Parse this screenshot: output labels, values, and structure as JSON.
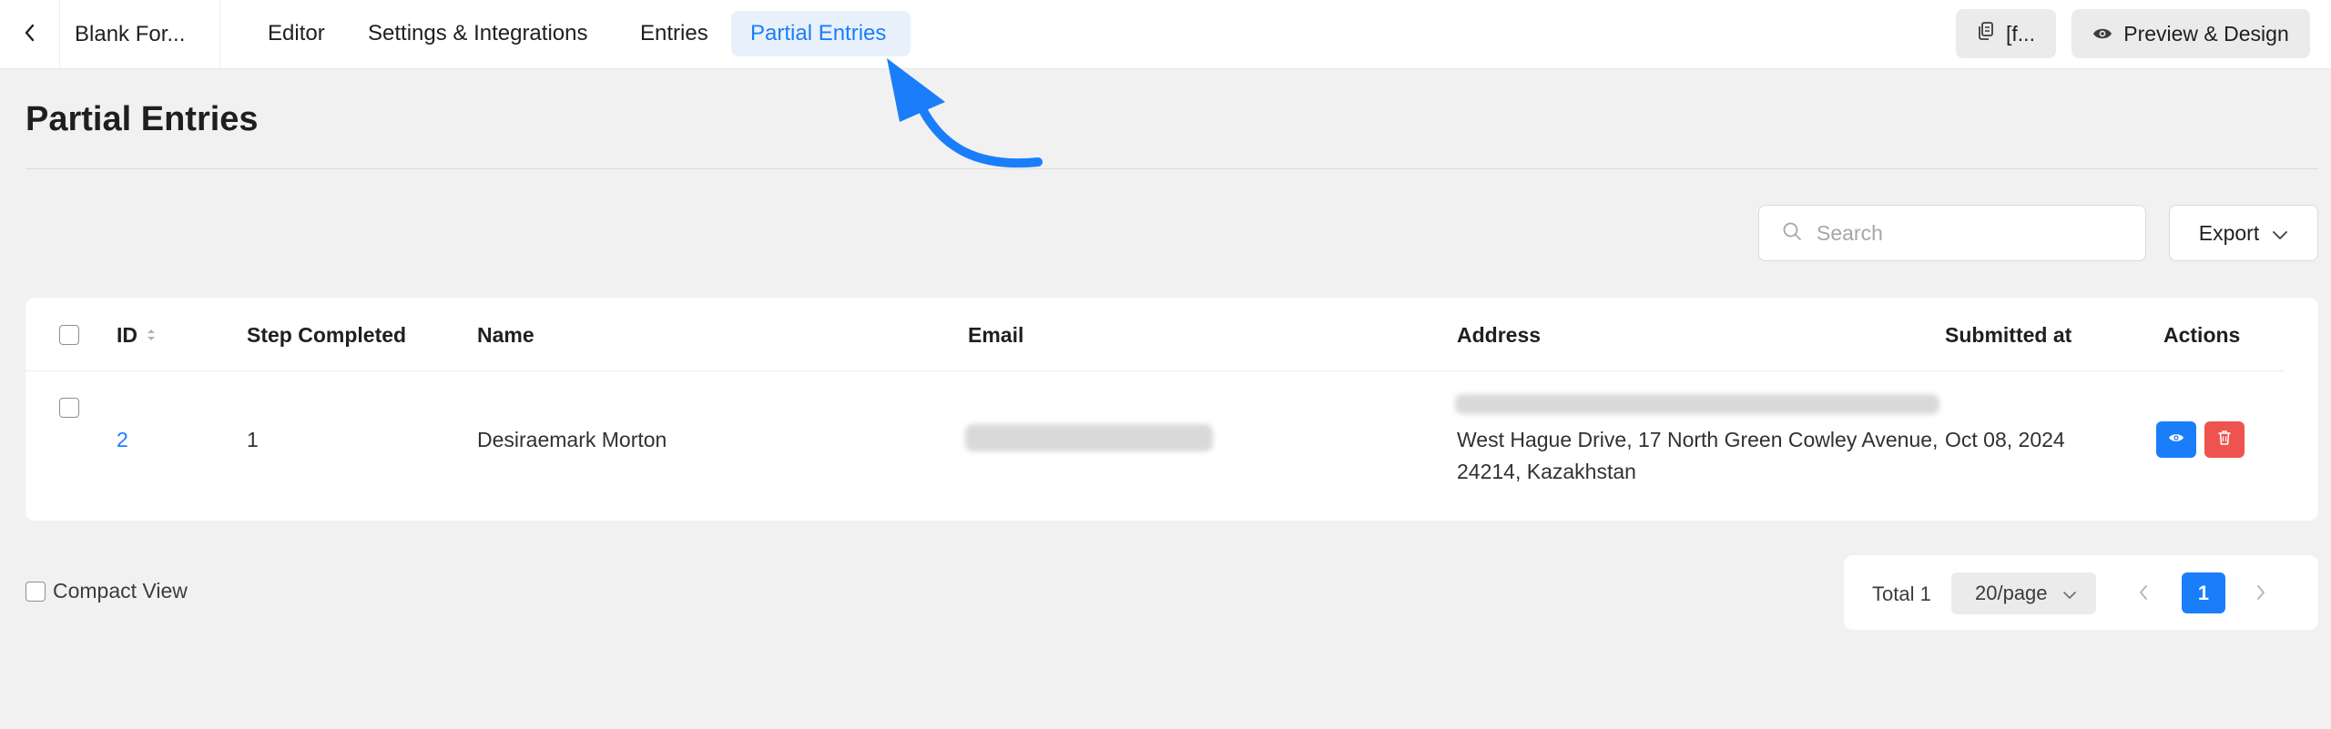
{
  "header": {
    "form_title": "Blank For...",
    "tabs": [
      {
        "label": "Editor"
      },
      {
        "label": "Settings & Integrations"
      },
      {
        "label": "Entries"
      },
      {
        "label": "Partial Entries",
        "active": true
      }
    ],
    "shortcode_label": "[f...",
    "preview_label": "Preview & Design"
  },
  "page": {
    "title": "Partial Entries"
  },
  "toolbar": {
    "search_placeholder": "Search",
    "export_label": "Export"
  },
  "table": {
    "columns": [
      "ID",
      "Step Completed",
      "Name",
      "Email",
      "Address",
      "Submitted at",
      "Actions"
    ],
    "rows": [
      {
        "id": "2",
        "step_completed": "1",
        "name": "Desiraemark Morton",
        "email": "",
        "address_line1": "West Hague Drive, 17 North Green Cowley Avenue,",
        "address_line2": "24214, Kazakhstan",
        "submitted_at": "Oct 08, 2024"
      }
    ]
  },
  "footer": {
    "compact_view_label": "Compact View",
    "total_label": "Total 1",
    "page_size_label": "20/page",
    "current_page": "1"
  },
  "colors": {
    "accent": "#1a7efb",
    "danger": "#ef5350",
    "active_tab_bg": "#e8f1fb"
  },
  "icons": [
    "chevron-left-icon",
    "copy-icon",
    "eye-icon",
    "search-icon",
    "chevron-down-icon",
    "sort-icon",
    "trash-icon",
    "chevron-right-icon",
    "annotation-arrow-icon"
  ]
}
